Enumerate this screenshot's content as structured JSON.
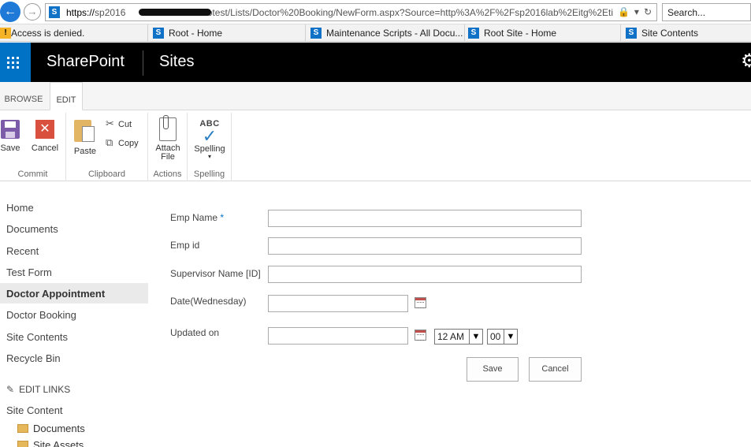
{
  "browser": {
    "url_scheme": "https://",
    "url_host_start": "sp2016",
    "url_rest": "om/sites/webtest/Lists/Doctor%20Booking/NewForm.aspx?Source=http%3A%2F%2Fsp2016lab%2Eitg%2Eti",
    "search_placeholder": "Search...",
    "icons": {
      "back": "back-arrow-icon",
      "forward": "forward-arrow-icon",
      "lock": "lock-icon",
      "refresh": "refresh-icon"
    }
  },
  "tabs": [
    {
      "label": "Access is denied.",
      "icon": "warning-icon"
    },
    {
      "label": "Root - Home",
      "icon": "sharepoint-icon"
    },
    {
      "label": "Maintenance Scripts - All Docu...",
      "icon": "sharepoint-icon"
    },
    {
      "label": "Root Site - Home",
      "icon": "sharepoint-icon"
    },
    {
      "label": "Site Contents",
      "icon": "sharepoint-icon"
    }
  ],
  "suitebar": {
    "brand": "SharePoint",
    "section": "Sites",
    "colors": {
      "waffle": "#0072c6",
      "bar": "#000000"
    }
  },
  "ribbon": {
    "tabs": [
      "BROWSE",
      "EDIT"
    ],
    "active_tab": "EDIT",
    "groups": {
      "commit": {
        "label": "Commit",
        "save": "Save",
        "cancel": "Cancel"
      },
      "clipboard": {
        "label": "Clipboard",
        "paste": "Paste",
        "cut": "Cut",
        "copy": "Copy"
      },
      "actions": {
        "label": "Actions",
        "attach_line1": "Attach",
        "attach_line2": "File"
      },
      "spelling": {
        "label": "Spelling",
        "abc": "ABC",
        "spelling": "Spelling"
      }
    }
  },
  "leftnav": {
    "items": [
      "Home",
      "Documents",
      "Recent",
      "Test Form",
      "Doctor Appointment",
      "Doctor Booking",
      "Site Contents",
      "Recycle Bin"
    ],
    "selected": "Doctor Appointment",
    "edit_links": "EDIT LINKS",
    "site_content": "Site Content",
    "tree": [
      "Documents",
      "Site Assets"
    ]
  },
  "form": {
    "fields": {
      "emp_name": {
        "label": "Emp Name",
        "required": "*",
        "value": ""
      },
      "emp_id": {
        "label": "Emp id",
        "value": ""
      },
      "supervisor": {
        "label": "Supervisor Name [ID]",
        "value": ""
      },
      "date": {
        "label": "Date(Wednesday)",
        "value": ""
      },
      "updated_on": {
        "label": "Updated on",
        "value": "",
        "hour": "12 AM",
        "minute": "00"
      }
    },
    "save": "Save",
    "cancel": "Cancel"
  }
}
